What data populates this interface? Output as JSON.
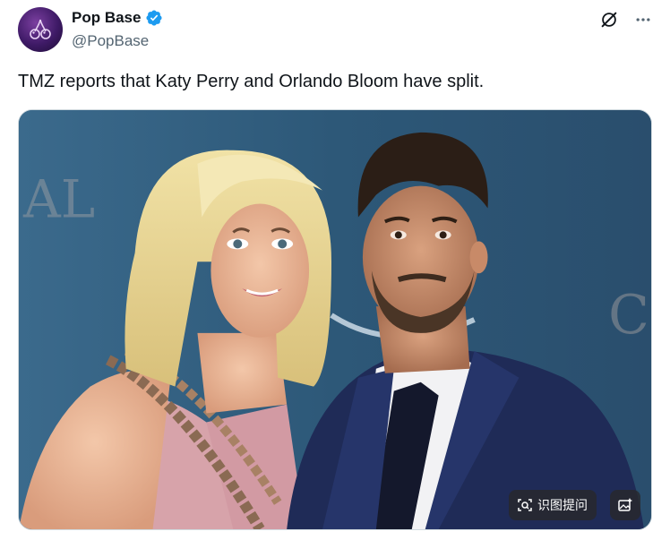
{
  "author": {
    "display_name": "Pop Base",
    "handle": "@PopBase",
    "verified": true,
    "avatar_icon": "cherry-icon"
  },
  "actions": {
    "grok_icon": "grok-icon",
    "more_icon": "more-horizontal-icon"
  },
  "tweet": {
    "text": "TMZ reports that Katy Perry and Orlando Bloom have split."
  },
  "media": {
    "alt": "Katy Perry and Orlando Bloom posing together at a premiere event",
    "overlay_buttons": {
      "translate_label": "识图提问",
      "translate_icon": "scan-icon",
      "image_icon": "image-sparkle-icon"
    }
  },
  "colors": {
    "verified": "#1d9bf0",
    "text_primary": "#0f1419",
    "text_secondary": "#536471",
    "backdrop": "#2f5d80"
  }
}
